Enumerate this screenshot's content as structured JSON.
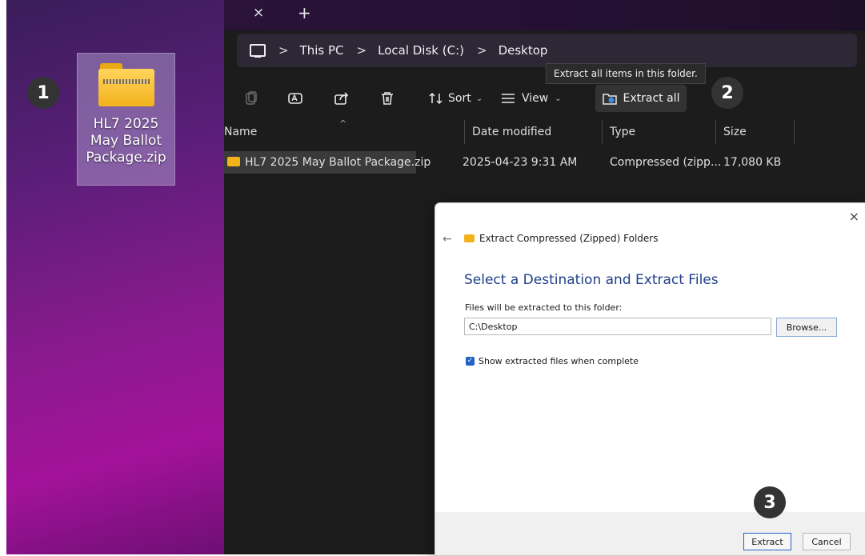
{
  "desktop": {
    "icon_label": "HL7 2025 May Ballot Package.zip",
    "icon_name": "zip-folder-icon"
  },
  "explorer": {
    "tab_close": "×",
    "tab_add": "+",
    "breadcrumb": [
      "This PC",
      "Local Disk (C:)",
      "Desktop"
    ],
    "breadcrumb_sep": ">",
    "tooltip": "Extract all items in this folder.",
    "toolbar": {
      "sort_label": "Sort",
      "view_label": "View",
      "extract_all_label": "Extract all",
      "icons": [
        "copy-icon",
        "rename-icon",
        "share-icon",
        "delete-icon",
        "sort-icon",
        "view-icon",
        "extract-icon"
      ]
    },
    "columns": [
      "Name",
      "Date modified",
      "Type",
      "Size"
    ],
    "files": [
      {
        "name": "HL7 2025 May Ballot Package.zip",
        "date": "2025-04-23 9:31 AM",
        "type": "Compressed (zipp...",
        "size": "17,080 KB"
      }
    ]
  },
  "dialog": {
    "window_title": "Extract Compressed (Zipped) Folders",
    "heading": "Select a Destination and Extract Files",
    "dest_label": "Files will be extracted to this folder:",
    "dest_value": "C:\\Desktop",
    "browse_label": "Browse...",
    "show_files_label": "Show extracted files when complete",
    "show_files_checked": true,
    "extract_label": "Extract",
    "cancel_label": "Cancel",
    "close": "×",
    "back": "←"
  },
  "steps": [
    "1",
    "2",
    "3"
  ],
  "colors": {
    "accent": "#1f63c4",
    "heading_blue": "#1e3f8a",
    "badge": "#333333",
    "folder": "#f2b21c"
  }
}
